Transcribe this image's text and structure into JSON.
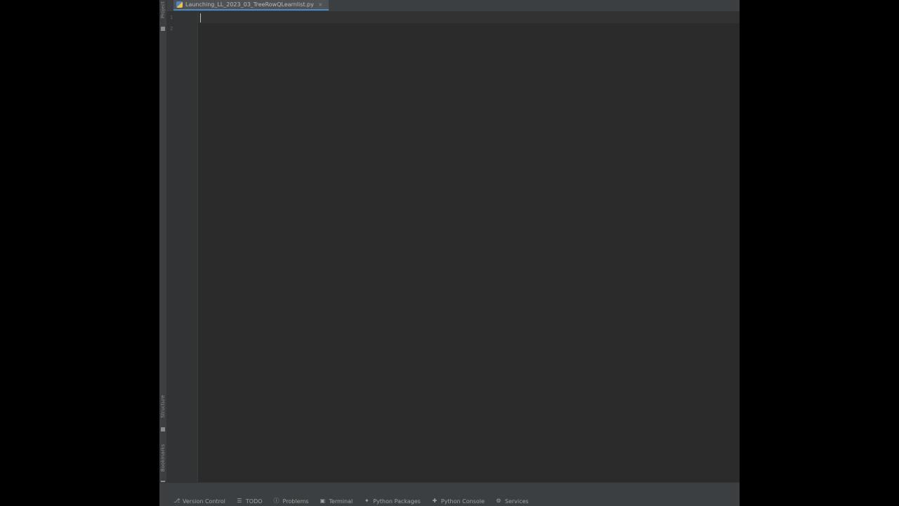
{
  "left_strip": {
    "project_label": "Project",
    "structure_label": "Structure",
    "bookmarks_label": "Bookmarks"
  },
  "tab": {
    "filename": "Launching_LL_2023_03_TreeRowQLearnlist.py",
    "close_glyph": "×",
    "icon": "python-file-icon"
  },
  "editor": {
    "line_numbers": [
      "1",
      "2"
    ]
  },
  "bottom_bar": {
    "items": [
      {
        "label": "Version Control",
        "icon": "branch-icon"
      },
      {
        "label": "TODO",
        "icon": "list-icon"
      },
      {
        "label": "Problems",
        "icon": "problems-icon"
      },
      {
        "label": "Terminal",
        "icon": "terminal-icon"
      },
      {
        "label": "Python Packages",
        "icon": "packages-icon"
      },
      {
        "label": "Python Console",
        "icon": "console-icon"
      },
      {
        "label": "Services",
        "icon": "gear-icon"
      }
    ]
  },
  "colors": {
    "background": "#2b2b2b",
    "panel": "#3c3f41",
    "accent": "#4a88c7"
  }
}
